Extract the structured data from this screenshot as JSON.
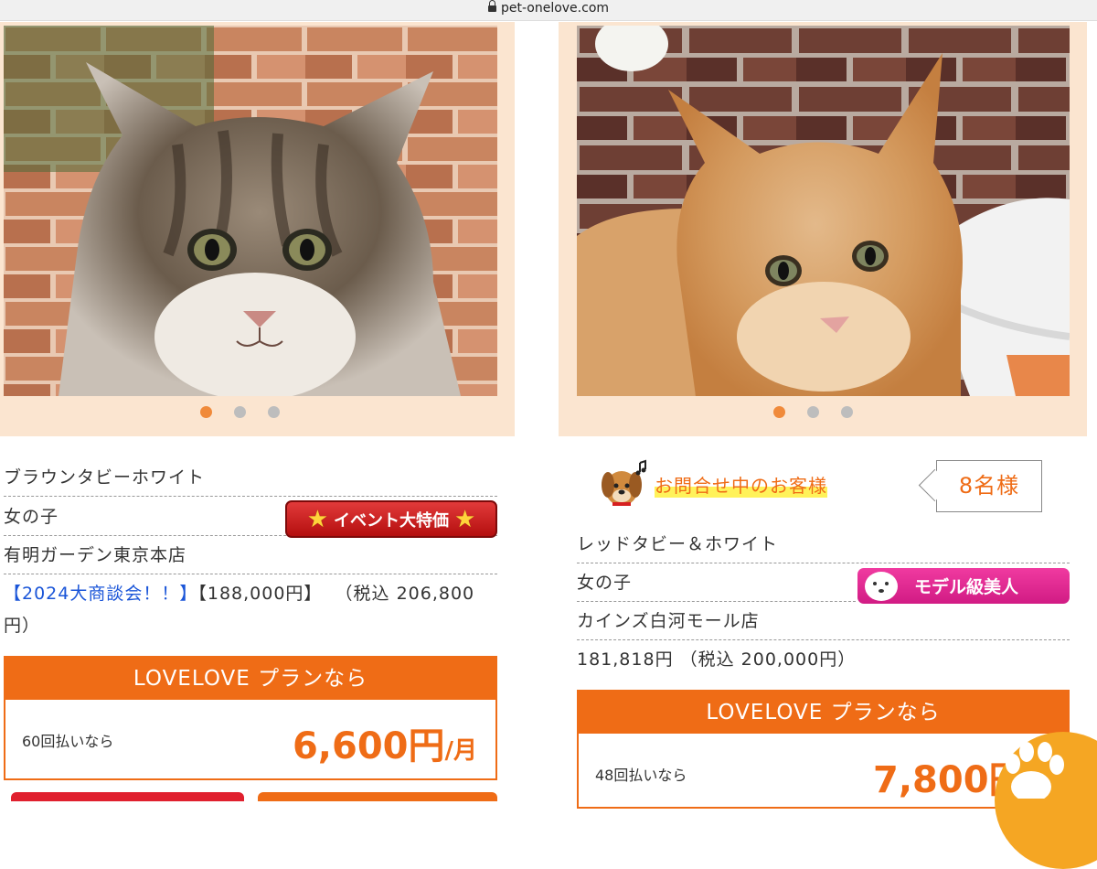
{
  "browser": {
    "url": "pet-onelove.com"
  },
  "cards": [
    {
      "color": "ブラウンタビーホワイト",
      "sex": "女の子",
      "badge": "イベント大特価",
      "store": "有明ガーデン東京本店",
      "campaign": "【2024大商談会！！】",
      "price": "【188,000円】",
      "tax_price": "（税込 206,800円）",
      "plan": {
        "title": "LOVELOVE プランなら",
        "installments": "60回払いなら",
        "amount": "6,600円",
        "unit": "/月"
      },
      "carousel": {
        "total": 3,
        "active": 1
      }
    },
    {
      "inquiry": {
        "label": "お問合せ中のお客様",
        "count": "8名様"
      },
      "color": "レッドタビー＆ホワイト",
      "sex": "女の子",
      "badge": "モデル級美人",
      "store": "カインズ白河モール店",
      "price_line": "181,818円 （税込 200,000円）",
      "plan": {
        "title": "LOVELOVE プランなら",
        "installments": "48回払いなら",
        "amount": "7,800円"
      },
      "carousel": {
        "total": 3,
        "active": 1
      }
    }
  ],
  "colors": {
    "accent": "#ef6c16",
    "frame": "#fbe5d0",
    "dot_active": "#f08a3a",
    "link": "#1a55d8"
  }
}
